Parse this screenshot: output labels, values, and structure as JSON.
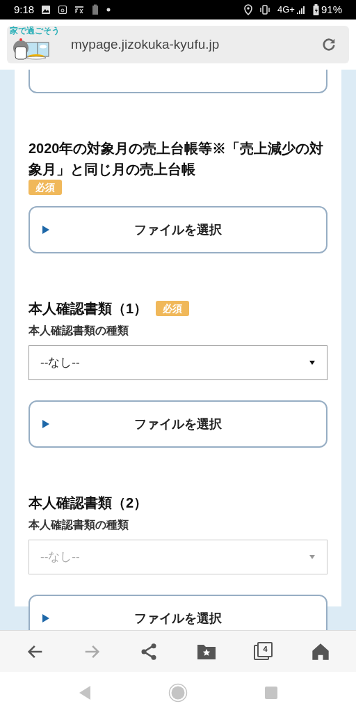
{
  "status_bar": {
    "time": "9:18",
    "network": "4G+",
    "battery": "91%"
  },
  "address_bar": {
    "logo_caption": "家で過ごそう",
    "url": "mypage.jizokuka-kyufu.jp"
  },
  "sections": [
    {
      "kind": "upload",
      "title": "2020年の対象月の売上台帳等※「売上減少の対象月」と同じ月の売上台帳",
      "required": true,
      "required_label": "必須",
      "button": "ファイルを選択"
    },
    {
      "kind": "id",
      "title": "本人確認書類（1）",
      "required": true,
      "required_label": "必須",
      "type_label": "本人確認書類の種類",
      "select": {
        "value": "--なし--",
        "disabled": false
      },
      "button": "ファイルを選択"
    },
    {
      "kind": "id",
      "title": "本人確認書類（2）",
      "required": false,
      "type_label": "本人確認書類の種類",
      "select": {
        "value": "--なし--",
        "disabled": true
      },
      "button": "ファイルを選択"
    }
  ],
  "toolbar": {
    "tab_count": "4",
    "forward_disabled": true
  }
}
